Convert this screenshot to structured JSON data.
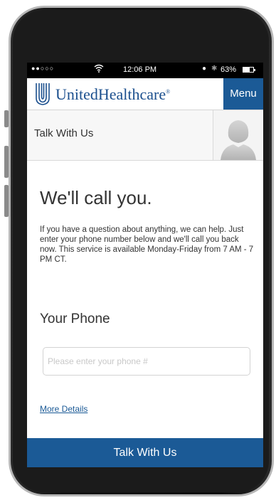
{
  "status_bar": {
    "signal": "●●○○○",
    "time": "12:06 PM",
    "battery": "63%",
    "battery_level": 0.63
  },
  "header": {
    "brand": "UnitedHealthcare",
    "trademark": "®",
    "menu_label": "Menu"
  },
  "talk_band": {
    "label": "Talk With Us"
  },
  "main": {
    "headline": "We'll call you.",
    "description": "If you have a question about anything, we can help.  Just enter your phone number below  and we'll call you back now. This service is available Monday-Friday from 7 AM - 7 PM CT.",
    "phone_label": "Your Phone",
    "phone_placeholder": "Please enter your phone #",
    "phone_value": "",
    "details_link": "More Details",
    "cta_label": "Talk With Us"
  },
  "colors": {
    "brand_blue": "#1b5a96",
    "logo_blue": "#1b4f8e"
  }
}
